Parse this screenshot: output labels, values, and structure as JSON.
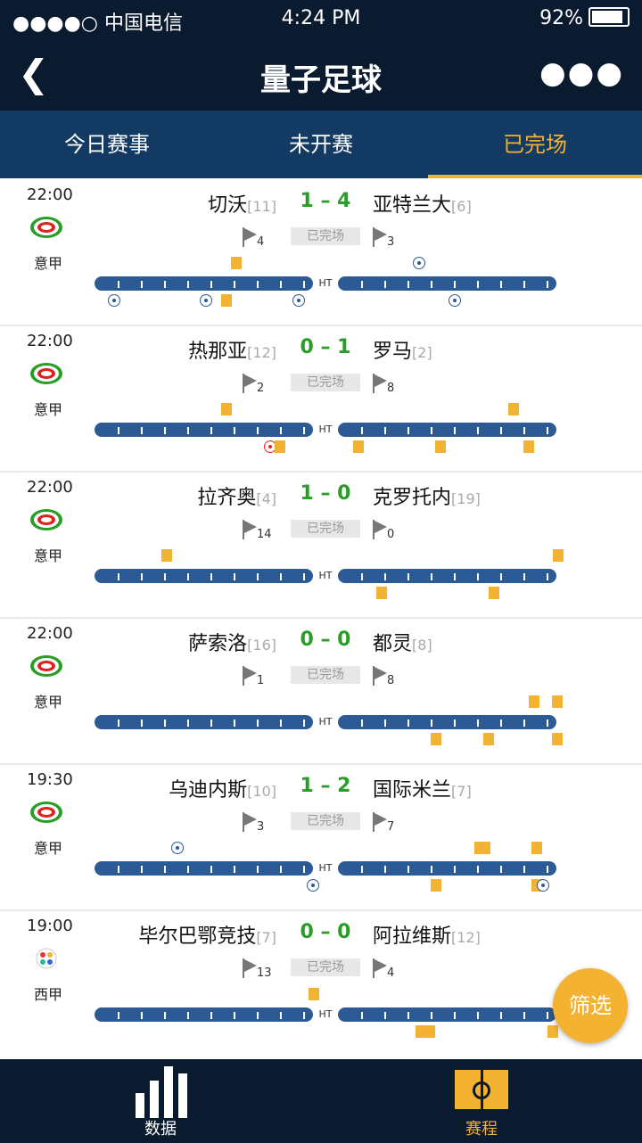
{
  "status_bar": {
    "carrier": "●●●●○ 中国电信",
    "time": "4:24 PM",
    "battery": "92%"
  },
  "nav": {
    "title": "量子足球",
    "back_icon": "back-arrow-icon",
    "more_icon": "more-icon"
  },
  "tabs": [
    {
      "label": "今日赛事",
      "active": false
    },
    {
      "label": "未开赛",
      "active": false
    },
    {
      "label": "已完场",
      "active": true
    }
  ],
  "matches": [
    {
      "time": "22:00",
      "league": "意甲",
      "home": "切沃",
      "home_rank": "[11]",
      "score": "1 – 4",
      "away": "亚特兰大",
      "away_rank": "[6]",
      "status": "已完场",
      "home_corners": "4",
      "away_corners": "3"
    },
    {
      "time": "22:00",
      "league": "意甲",
      "home": "热那亚",
      "home_rank": "[12]",
      "score": "0 – 1",
      "away": "罗马",
      "away_rank": "[2]",
      "status": "已完场",
      "home_corners": "2",
      "away_corners": "8"
    },
    {
      "time": "22:00",
      "league": "意甲",
      "home": "拉齐奥",
      "home_rank": "[4]",
      "score": "1 – 0",
      "away": "克罗托内",
      "away_rank": "[19]",
      "status": "已完场",
      "home_corners": "14",
      "away_corners": "0"
    },
    {
      "time": "22:00",
      "league": "意甲",
      "home": "萨索洛",
      "home_rank": "[16]",
      "score": "0 – 0",
      "away": "都灵",
      "away_rank": "[8]",
      "status": "已完场",
      "home_corners": "1",
      "away_corners": "8"
    },
    {
      "time": "19:30",
      "league": "意甲",
      "home": "乌迪内斯",
      "home_rank": "[10]",
      "score": "1 – 2",
      "away": "国际米兰",
      "away_rank": "[7]",
      "status": "已完场",
      "home_corners": "3",
      "away_corners": "7"
    },
    {
      "time": "19:00",
      "league": "西甲",
      "home": "毕尔巴鄂竞技",
      "home_rank": "[7]",
      "score": "0 – 0",
      "away": "阿拉维斯",
      "away_rank": "[12]",
      "status": "已完场",
      "home_corners": "13",
      "away_corners": "4"
    }
  ],
  "timeline_ht_label": "HT",
  "filter_button": "筛选",
  "bottom_nav": [
    {
      "label": "数据",
      "icon": "bar-chart-icon",
      "active": false
    },
    {
      "label": "赛程",
      "icon": "pitch-icon",
      "active": true
    }
  ],
  "colors": {
    "header": "#0a1a2f",
    "tabbar": "#123a63",
    "accent": "#f4b233",
    "score": "#2a9d27",
    "timeline": "#2b5a95"
  }
}
